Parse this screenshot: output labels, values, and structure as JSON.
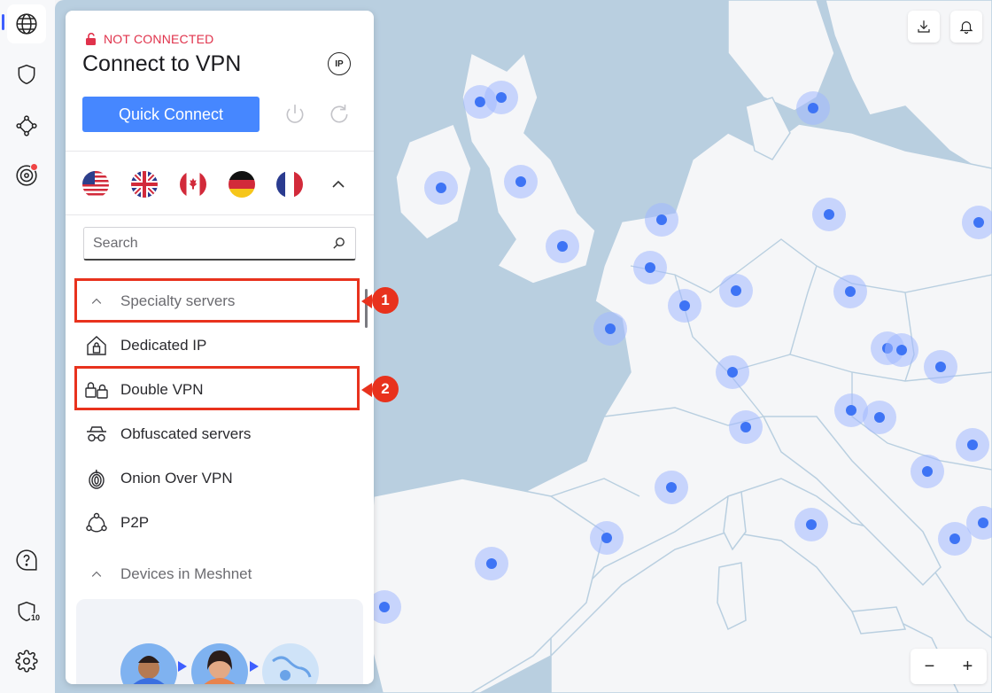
{
  "rail": {
    "items": [
      "globe-icon",
      "shield-icon",
      "meshnet-icon",
      "target-icon"
    ],
    "bottom": [
      "help-icon",
      "threat-protection-icon",
      "settings-icon"
    ],
    "threat_badge": "10",
    "accent": "#3e5fff"
  },
  "panel": {
    "status": "NOT CONNECTED",
    "title": "Connect to VPN",
    "ip_label": "IP",
    "quick_connect": "Quick Connect",
    "search_placeholder": "Search",
    "specialty_header": "Specialty servers",
    "items": [
      {
        "label": "Dedicated IP",
        "icon": "dedicated-ip-icon"
      },
      {
        "label": "Double VPN",
        "icon": "double-vpn-icon"
      },
      {
        "label": "Obfuscated servers",
        "icon": "obfuscated-icon"
      },
      {
        "label": "Onion Over VPN",
        "icon": "onion-icon"
      },
      {
        "label": "P2P",
        "icon": "p2p-icon"
      }
    ],
    "meshnet_header": "Devices in Meshnet",
    "flags": [
      "us-flag",
      "uk-flag",
      "canada-flag",
      "germany-flag",
      "france-flag"
    ]
  },
  "annotations": [
    "1",
    "2"
  ],
  "map": {
    "zoom_out": "−",
    "zoom_in": "+"
  },
  "colors": {
    "status": "#e0324b",
    "button": "#4687ff",
    "sea": "#b9cfe0",
    "land": "#f5f6f8",
    "pin": "#3e74f5",
    "annotation": "#e8321d"
  }
}
